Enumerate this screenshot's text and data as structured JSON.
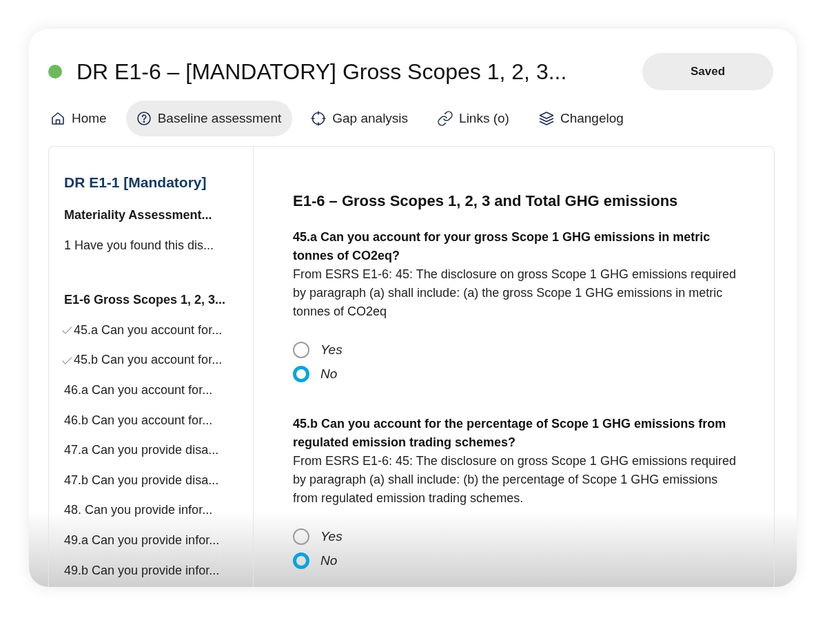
{
  "header": {
    "title": "DR E1-6 – [MANDATORY] Gross Scopes 1, 2, 3...",
    "save_button": "Saved"
  },
  "tabs": [
    {
      "label": "Home",
      "selected": false
    },
    {
      "label": "Baseline assessment",
      "selected": true
    },
    {
      "label": "Gap analysis",
      "selected": false
    },
    {
      "label": "Links (o)",
      "selected": false
    },
    {
      "label": "Changelog",
      "selected": false
    }
  ],
  "sidebar": {
    "title": "DR E1-1 [Mandatory]",
    "groups": [
      {
        "heading": "Materiality Assessment...",
        "items": [
          {
            "label": "1 Have you found this dis...",
            "checked": false
          }
        ]
      },
      {
        "heading": "E1-6 Gross Scopes 1, 2, 3...",
        "items": [
          {
            "label": "45.a Can you account for...",
            "checked": true
          },
          {
            "label": "45.b Can you account for...",
            "checked": true
          },
          {
            "label": "46.a Can you account for...",
            "checked": false
          },
          {
            "label": "46.b Can you account for...",
            "checked": false
          },
          {
            "label": "47.a Can you provide disa...",
            "checked": false
          },
          {
            "label": "47.b Can you provide disa...",
            "checked": false
          },
          {
            "label": "48. Can you provide infor...",
            "checked": false
          },
          {
            "label": "49.a Can you provide infor...",
            "checked": false
          },
          {
            "label": "49.b Can you provide infor...",
            "checked": false
          }
        ]
      }
    ]
  },
  "main": {
    "heading": "E1-6 – Gross Scopes 1, 2, 3 and Total GHG emissions",
    "questions": [
      {
        "title": "45.a Can you account for your gross Scope 1 GHG emissions in metric tonnes of CO2eq?",
        "description": "From ESRS E1-6: 45: The disclosure on gross Scope 1 GHG emissions required by paragraph (a) shall include: (a) the gross Scope 1 GHG emissions in metric tonnes of CO2eq",
        "options": [
          {
            "label": "Yes",
            "selected": false
          },
          {
            "label": "No",
            "selected": true
          }
        ]
      },
      {
        "title": "45.b Can you account for the percentage of Scope 1 GHG emissions from regulated emission trading schemes?",
        "description": "From ESRS E1-6: 45: The disclosure on gross Scope 1 GHG emissions required by paragraph (a) shall include: (b) the percentage of Scope 1 GHG emissions from regulated emission trading schemes.",
        "options": [
          {
            "label": "Yes",
            "selected": false
          },
          {
            "label": "No",
            "selected": true
          }
        ]
      }
    ]
  }
}
